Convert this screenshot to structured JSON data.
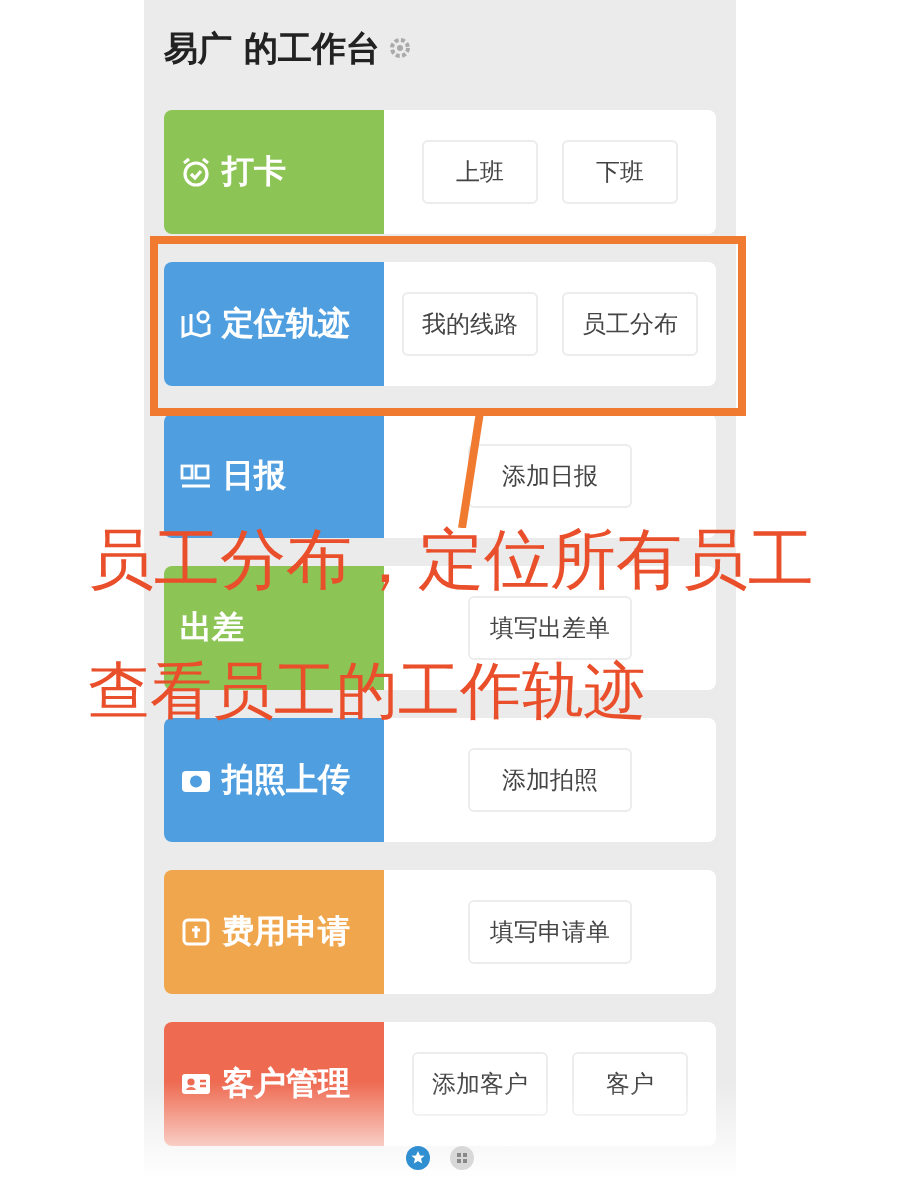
{
  "title": "易广 的工作台",
  "cards": [
    {
      "kind": "clock",
      "label": "打卡",
      "color": "#8cc455",
      "buttons": [
        "上班",
        "下班"
      ]
    },
    {
      "kind": "location",
      "label": "定位轨迹",
      "color": "#4e9ee0",
      "buttons": [
        "我的线路",
        "员工分布"
      ]
    },
    {
      "kind": "report",
      "label": "日报",
      "color": "#4e9ee0",
      "buttons": [
        "添加日报"
      ]
    },
    {
      "kind": "trip",
      "label": "出差",
      "color": "#8cc455",
      "buttons": [
        "填写出差单"
      ]
    },
    {
      "kind": "camera",
      "label": "拍照上传",
      "color": "#4e9ee0",
      "buttons": [
        "添加拍照"
      ]
    },
    {
      "kind": "expense",
      "label": "费用申请",
      "color": "#f0a64c",
      "buttons": [
        "填写申请单"
      ]
    },
    {
      "kind": "customer",
      "label": "客户管理",
      "color": "#ee6b52",
      "buttons": [
        "添加客户",
        "客户"
      ]
    }
  ],
  "pager": [
    {
      "kind": "star",
      "selected": true
    },
    {
      "kind": "grid",
      "selected": false
    }
  ],
  "annotation": {
    "lines": [
      "员工分布，定位所有员工",
      "查看员工的工作轨迹"
    ]
  }
}
